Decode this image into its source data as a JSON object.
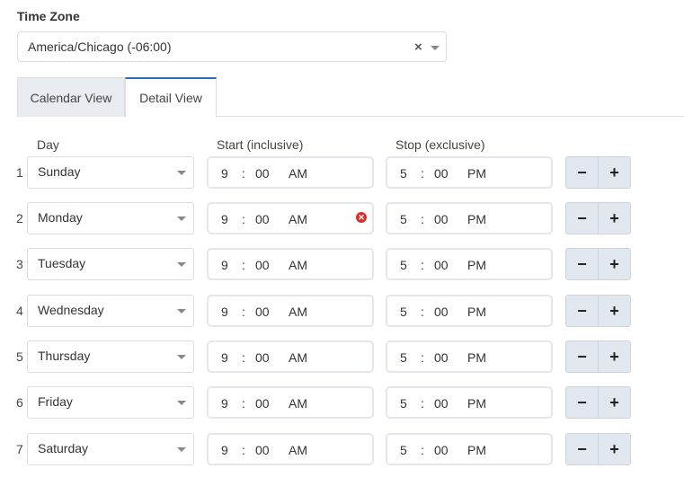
{
  "timezone": {
    "label": "Time Zone",
    "value": "America/Chicago (-06:00)",
    "clear_glyph": "×"
  },
  "tabs": [
    {
      "label": "Calendar View",
      "active": false
    },
    {
      "label": "Detail View",
      "active": true
    }
  ],
  "headers": {
    "day": "Day",
    "start": "Start (inclusive)",
    "stop": "Stop (exclusive)"
  },
  "rows": [
    {
      "index": "1",
      "day": "Sunday",
      "start": {
        "h": "9",
        "m": "00",
        "ap": "AM"
      },
      "stop": {
        "h": "5",
        "m": "00",
        "ap": "PM"
      },
      "start_error": false
    },
    {
      "index": "2",
      "day": "Monday",
      "start": {
        "h": "9",
        "m": "00",
        "ap": "AM"
      },
      "stop": {
        "h": "5",
        "m": "00",
        "ap": "PM"
      },
      "start_error": true
    },
    {
      "index": "3",
      "day": "Tuesday",
      "start": {
        "h": "9",
        "m": "00",
        "ap": "AM"
      },
      "stop": {
        "h": "5",
        "m": "00",
        "ap": "PM"
      },
      "start_error": false
    },
    {
      "index": "4",
      "day": "Wednesday",
      "start": {
        "h": "9",
        "m": "00",
        "ap": "AM"
      },
      "stop": {
        "h": "5",
        "m": "00",
        "ap": "PM"
      },
      "start_error": false
    },
    {
      "index": "5",
      "day": "Thursday",
      "start": {
        "h": "9",
        "m": "00",
        "ap": "AM"
      },
      "stop": {
        "h": "5",
        "m": "00",
        "ap": "PM"
      },
      "start_error": false
    },
    {
      "index": "6",
      "day": "Friday",
      "start": {
        "h": "9",
        "m": "00",
        "ap": "AM"
      },
      "stop": {
        "h": "5",
        "m": "00",
        "ap": "PM"
      },
      "start_error": false
    },
    {
      "index": "7",
      "day": "Saturday",
      "start": {
        "h": "9",
        "m": "00",
        "ap": "AM"
      },
      "stop": {
        "h": "5",
        "m": "00",
        "ap": "PM"
      },
      "start_error": false
    }
  ],
  "buttons": {
    "minus": "−",
    "plus": "+"
  },
  "colors": {
    "accent": "#2a6eb8",
    "error": "#d9302c",
    "button_bg": "#e1e7ee"
  },
  "icons": {
    "clear": "clear-icon",
    "dropdown": "chevron-down-icon",
    "error": "error-circle-icon"
  }
}
